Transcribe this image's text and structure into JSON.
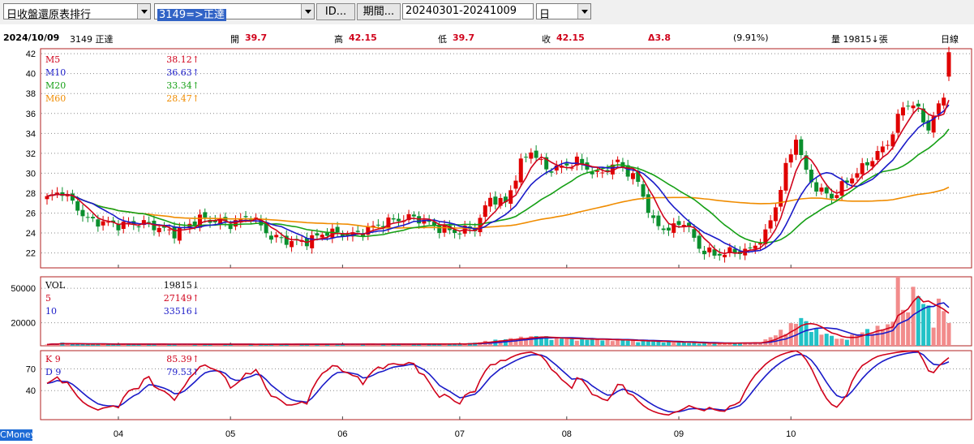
{
  "toolbar": {
    "report_select": "日收盤還原表排行",
    "stock_select": "3149=>正達",
    "id_button": "ID...",
    "period_button": "期間...",
    "date_range": "20240301-20241009",
    "freq_select": "日"
  },
  "header": {
    "date": "2024/10/09",
    "stock": "3149 正達",
    "open_label": "開",
    "open_value": "39.7",
    "high_label": "高",
    "high_value": "42.15",
    "low_label": "低",
    "low_value": "39.7",
    "close_label": "收",
    "close_value": "42.15",
    "change": "Δ3.8",
    "change_pct": "(9.91%)",
    "volume": "量 19815↓張",
    "period_label": "日線"
  },
  "legend_price": [
    {
      "name": "M5",
      "value": "38.12↑",
      "color": "#d0021b"
    },
    {
      "name": "M10",
      "value": "36.63↑",
      "color": "#1a1ac8"
    },
    {
      "name": "M20",
      "value": "33.34↑",
      "color": "#16a016"
    },
    {
      "name": "M60",
      "value": "28.47↑",
      "color": "#f08c00"
    }
  ],
  "legend_vol": [
    {
      "name": "VOL",
      "value": "19815↓",
      "color": "#000000"
    },
    {
      "name": "5",
      "value": "27149↑",
      "color": "#d0021b"
    },
    {
      "name": "10",
      "value": "33516↓",
      "color": "#1a1ac8"
    }
  ],
  "legend_kd": [
    {
      "name": "K 9",
      "value": "85.39↑",
      "color": "#d0021b"
    },
    {
      "name": "D 9",
      "value": "79.53↑",
      "color": "#1a1ac8"
    }
  ],
  "brand": "CMoney",
  "chart_data": {
    "type": "candlestick",
    "months": [
      "04",
      "05",
      "06",
      "07",
      "08",
      "09",
      "10"
    ],
    "price_axis": {
      "ticks": [
        22,
        24,
        26,
        28,
        30,
        32,
        34,
        36,
        38,
        40,
        42
      ],
      "ylim": [
        20.5,
        42.5
      ]
    },
    "volume_axis": {
      "ticks": [
        20000,
        50000
      ],
      "ylim": [
        0,
        60000
      ]
    },
    "kd_axis": {
      "ticks": [
        40,
        70
      ],
      "ylim": [
        0,
        95
      ]
    },
    "anchors": [
      [
        0,
        27.5
      ],
      [
        3,
        28.2
      ],
      [
        8,
        25.3
      ],
      [
        14,
        24.8
      ],
      [
        19,
        25.0
      ],
      [
        25,
        24.0
      ],
      [
        30,
        25.5
      ],
      [
        36,
        24.9
      ],
      [
        40,
        25.7
      ],
      [
        44,
        23.6
      ],
      [
        48,
        23.1
      ],
      [
        51,
        23.2
      ],
      [
        55,
        24.1
      ],
      [
        60,
        23.8
      ],
      [
        64,
        24.6
      ],
      [
        68,
        25.3
      ],
      [
        72,
        25.6
      ],
      [
        77,
        24.5
      ],
      [
        80,
        24.1
      ],
      [
        84,
        24.5
      ],
      [
        87,
        27.5
      ],
      [
        90,
        27.0
      ],
      [
        93,
        31.0
      ],
      [
        95,
        32.3
      ],
      [
        98,
        30.4
      ],
      [
        101,
        30.6
      ],
      [
        104,
        31.2
      ],
      [
        108,
        29.8
      ],
      [
        112,
        31.1
      ],
      [
        116,
        29.1
      ],
      [
        119,
        25.0
      ],
      [
        122,
        24.3
      ],
      [
        125,
        25.2
      ],
      [
        128,
        22.5
      ],
      [
        131,
        21.8
      ],
      [
        134,
        22.1
      ],
      [
        138,
        22.3
      ],
      [
        141,
        23.9
      ],
      [
        143,
        26.7
      ],
      [
        145,
        30.5
      ],
      [
        147,
        33.6
      ],
      [
        149,
        30.0
      ],
      [
        151,
        28.5
      ],
      [
        154,
        27.6
      ],
      [
        157,
        29.2
      ],
      [
        161,
        31.0
      ],
      [
        165,
        33.0
      ],
      [
        168,
        36.7
      ],
      [
        170,
        37.0
      ],
      [
        173,
        34.5
      ],
      [
        176,
        37.8
      ],
      [
        177,
        42.15
      ]
    ],
    "volume_anchors": [
      [
        0,
        1500
      ],
      [
        40,
        1200
      ],
      [
        82,
        1500
      ],
      [
        86,
        3500
      ],
      [
        92,
        6000
      ],
      [
        96,
        7500
      ],
      [
        100,
        6000
      ],
      [
        110,
        5000
      ],
      [
        120,
        3500
      ],
      [
        130,
        2000
      ],
      [
        140,
        2500
      ],
      [
        143,
        9000
      ],
      [
        146,
        16000
      ],
      [
        148,
        22000
      ],
      [
        150,
        14000
      ],
      [
        153,
        9000
      ],
      [
        156,
        5000
      ],
      [
        160,
        11000
      ],
      [
        164,
        15000
      ],
      [
        166,
        18000
      ],
      [
        168,
        25000
      ],
      [
        170,
        43000
      ],
      [
        172,
        36000
      ],
      [
        174,
        21000
      ],
      [
        176,
        30000
      ],
      [
        177,
        19815
      ]
    ],
    "volume_spikes": [
      [
        3,
        2800
      ],
      [
        167,
        60000
      ],
      [
        175,
        41000
      ]
    ]
  }
}
